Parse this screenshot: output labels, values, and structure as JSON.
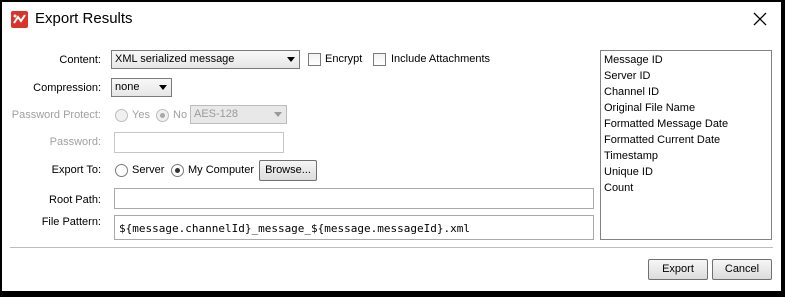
{
  "window": {
    "title": "Export Results",
    "app_icon": "mirth-app-icon",
    "close_icon": "close-icon"
  },
  "labels": {
    "content": "Content:",
    "compression": "Compression:",
    "password_protect": "Password Protect:",
    "password": "Password:",
    "export_to": "Export To:",
    "root_path": "Root Path:",
    "file_pattern": "File Pattern:"
  },
  "content": {
    "selected": "XML serialized message",
    "encrypt_label": "Encrypt",
    "encrypt_checked": false,
    "include_attachments_label": "Include Attachments",
    "include_attachments_checked": false
  },
  "compression": {
    "selected": "none"
  },
  "password_protect": {
    "yes_label": "Yes",
    "no_label": "No",
    "selected": "No",
    "algorithm": "AES-128"
  },
  "password": {
    "value": ""
  },
  "export_to": {
    "server_label": "Server",
    "my_computer_label": "My Computer",
    "selected": "My Computer",
    "browse_label": "Browse..."
  },
  "root_path": {
    "value": ""
  },
  "file_pattern": {
    "value": "${message.channelId}_message_${message.messageId}.xml"
  },
  "variables": [
    "Message ID",
    "Server ID",
    "Channel ID",
    "Original File Name",
    "Formatted Message Date",
    "Formatted Current Date",
    "Timestamp",
    "Unique ID",
    "Count"
  ],
  "buttons": {
    "export": "Export",
    "cancel": "Cancel"
  }
}
